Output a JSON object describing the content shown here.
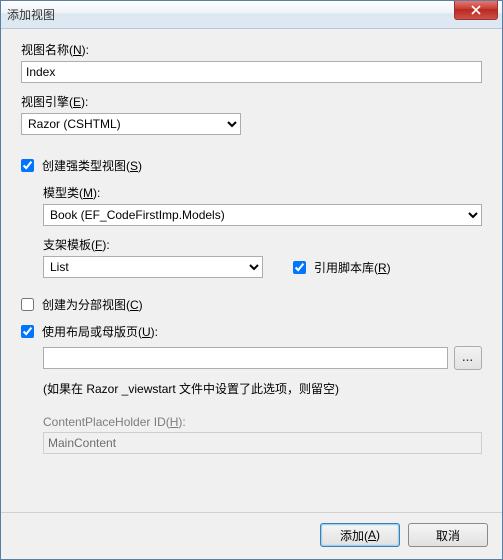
{
  "title": "添加视图",
  "closeIcon": "close-icon",
  "viewName": {
    "label_pre": "视图名称(",
    "label_key": "N",
    "label_post": "):",
    "value": "Index"
  },
  "viewEngine": {
    "label_pre": "视图引擎(",
    "label_key": "E",
    "label_post": "):",
    "value": "Razor (CSHTML)"
  },
  "stronglyTyped": {
    "checked": true,
    "label_pre": "创建强类型视图(",
    "label_key": "S",
    "label_post": ")"
  },
  "modelClass": {
    "label_pre": "模型类(",
    "label_key": "M",
    "label_post": "):",
    "value": "Book (EF_CodeFirstImp.Models)"
  },
  "scaffold": {
    "label_pre": "支架模板(",
    "label_key": "F",
    "label_post": "):",
    "value": "List"
  },
  "referenceScripts": {
    "checked": true,
    "label_pre": "引用脚本库(",
    "label_key": "R",
    "label_post": ")"
  },
  "partialView": {
    "checked": false,
    "label_pre": "创建为分部视图(",
    "label_key": "C",
    "label_post": ")"
  },
  "useLayout": {
    "checked": true,
    "label_pre": "使用布局或母版页(",
    "label_key": "U",
    "label_post": "):"
  },
  "layoutPath": {
    "value": "",
    "browseLabel": "..."
  },
  "layoutHint": "(如果在 Razor _viewstart 文件中设置了此选项，则留空)",
  "contentPlaceholder": {
    "label_pre": "ContentPlaceHolder ID(",
    "label_key": "H",
    "label_post": "):",
    "value": "MainContent"
  },
  "buttons": {
    "add_pre": "添加(",
    "add_key": "A",
    "add_post": ")",
    "cancel": "取消"
  }
}
